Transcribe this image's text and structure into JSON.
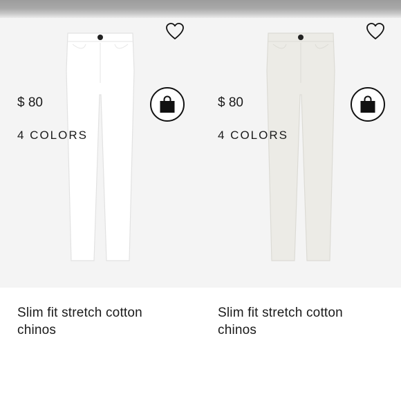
{
  "products": [
    {
      "title": "Slim fit stretch cotton chinos",
      "price": "$ 80",
      "colors": "4 COLORS",
      "image_color": "#ffffff",
      "wishlist_icon": "heart-outline-icon",
      "bag_icon": "shopping-bag-icon"
    },
    {
      "title": "Slim fit stretch cotton chinos",
      "price": "$ 80",
      "colors": "4 COLORS",
      "image_color": "#ecebe6",
      "wishlist_icon": "heart-outline-icon",
      "bag_icon": "shopping-bag-icon"
    }
  ],
  "colors": {
    "image_background": "#f4f4f4",
    "text": "#1a1a1a",
    "button_border": "#111111"
  }
}
